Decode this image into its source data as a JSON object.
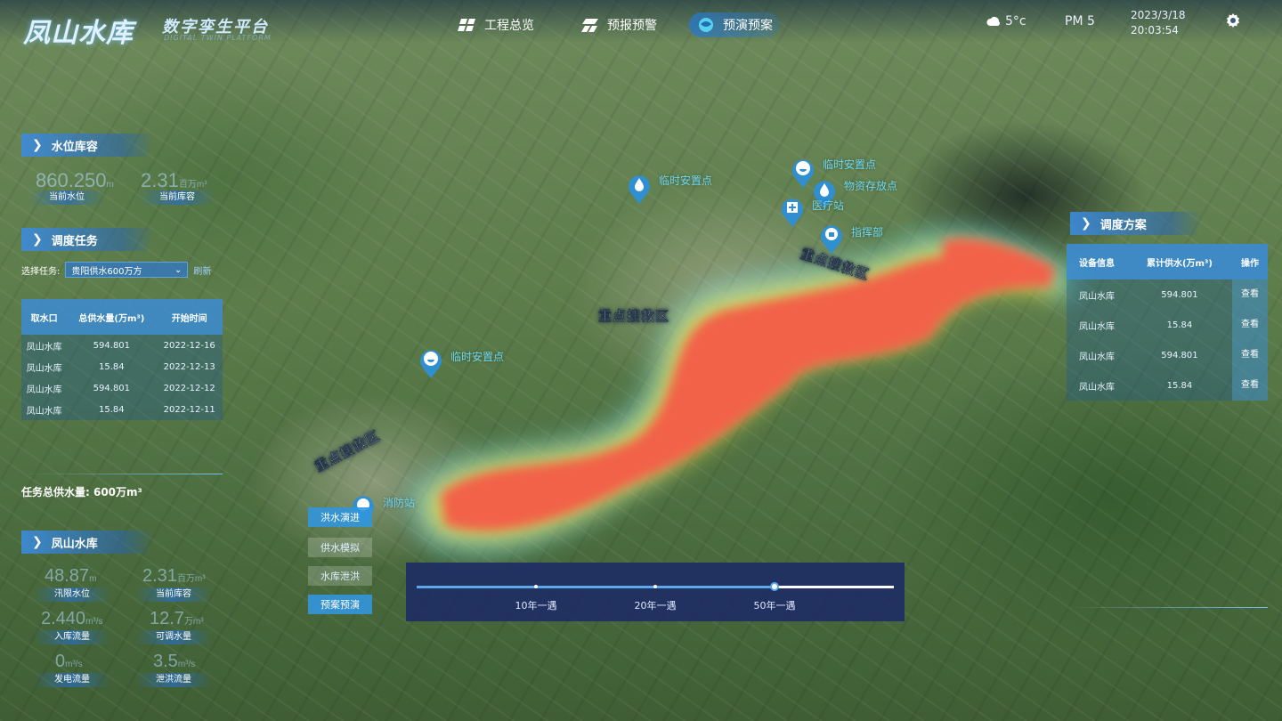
{
  "header": {
    "logo": "凤山水库",
    "subtitle": "数字孪生平台",
    "subtitle_en": "DIGITAL TWIN PLATFORM",
    "nav": [
      {
        "label": "工程总览",
        "icon": "grid-icon"
      },
      {
        "label": "预报预警",
        "icon": "rain-icon"
      },
      {
        "label": "预演预案",
        "icon": "globe-icon"
      }
    ],
    "weather": "5°c",
    "pm": "PM 5",
    "date": "2023/3/18",
    "time": "20:03:54"
  },
  "water_panel": {
    "title": "水位库容",
    "level_value": "860.250",
    "level_unit": "m",
    "level_label": "当前水位",
    "capacity_value": "2.31",
    "capacity_unit": "百万m³",
    "capacity_label": "当前库容"
  },
  "dispatch_panel": {
    "title": "调度任务",
    "select_label": "选择任务:",
    "select_value": "贵阳供水600万方",
    "refresh": "刷新",
    "columns": [
      "取水口",
      "总供水量(万m³)",
      "开始时间"
    ],
    "rows": [
      [
        "凤山水库",
        "594.801",
        "2022-12-16"
      ],
      [
        "凤山水库",
        "15.84",
        "2022-12-13"
      ],
      [
        "凤山水库",
        "594.801",
        "2022-12-12"
      ],
      [
        "凤山水库",
        "15.84",
        "2022-12-11"
      ]
    ],
    "total": "任务总供水量: 600万m³"
  },
  "reservoir_panel": {
    "title": "凤山水库",
    "stats": [
      {
        "value": "48.87",
        "unit": "m",
        "label": "汛限水位"
      },
      {
        "value": "2.31",
        "unit": "百万m³",
        "label": "当前库容"
      },
      {
        "value": "2.440",
        "unit": "m³/s",
        "label": "入库流量"
      },
      {
        "value": "12.7",
        "unit": "万m³",
        "label": "可调水量"
      },
      {
        "value": "0",
        "unit": "m³/s",
        "label": "发电流量"
      },
      {
        "value": "3.5",
        "unit": "m³/s",
        "label": "泄洪流量"
      }
    ]
  },
  "sim_buttons": [
    {
      "label": "洪水演进",
      "active": true
    },
    {
      "label": "供水模拟",
      "active": false
    },
    {
      "label": "水库泄洪",
      "active": false
    },
    {
      "label": "预案预演",
      "active": true
    }
  ],
  "return_period_slider": {
    "options": [
      "10年一遇",
      "20年一遇",
      "50年一遇"
    ],
    "selected": "50年一遇",
    "value_fraction": 0.75
  },
  "scheme_panel": {
    "title": "调度方案",
    "columns": [
      "设备信息",
      "累计供水(万m³)",
      "操作"
    ],
    "rows": [
      [
        "凤山水库",
        "594.801",
        "查看"
      ],
      [
        "凤山水库",
        "15.84",
        "查看"
      ],
      [
        "凤山水库",
        "594.801",
        "查看"
      ],
      [
        "凤山水库",
        "15.84",
        "查看"
      ]
    ]
  },
  "map": {
    "zones": [
      "重点搜救区",
      "重点搜救区",
      "重点搜救区"
    ],
    "pins": [
      {
        "label": "临时安置点",
        "icon": "shelter-icon"
      },
      {
        "label": "物资存放点",
        "icon": "water-drop-icon"
      },
      {
        "label": "临时安置点",
        "icon": "shelter-icon"
      },
      {
        "label": "医疗站",
        "icon": "hospital-icon"
      },
      {
        "label": "指挥部",
        "icon": "command-icon"
      },
      {
        "label": "临时安置点",
        "icon": "shelter-icon"
      },
      {
        "label": "消防站",
        "icon": "fire-station-icon"
      }
    ],
    "flood_colors": [
      "#f2624a",
      "#f7a14a",
      "#e8e04a",
      "#8fe070",
      "#4ac0e8"
    ]
  }
}
